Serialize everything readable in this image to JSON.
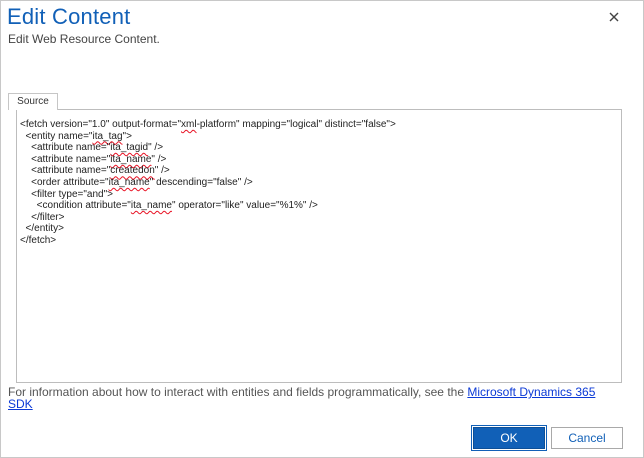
{
  "dialog": {
    "title": "Edit Content",
    "subtitle": "Edit Web Resource Content.",
    "close_icon": "close-icon"
  },
  "tabs": [
    {
      "label": "Source",
      "selected": true
    }
  ],
  "editor": {
    "lines": [
      "<fetch version=\"1.0\" output-format=\"xml-platform\" mapping=\"logical\" distinct=\"false\">",
      "  <entity name=\"ita_tag\">",
      "    <attribute name=\"ita_tagid\" />",
      "    <attribute name=\"ita_name\" />",
      "    <attribute name=\"createdon\" />",
      "    <order attribute=\"ita_name\" descending=\"false\" />",
      "    <filter type=\"and\">",
      "      <condition attribute=\"ita_name\" operator=\"like\" value=\"%1%\" />",
      "    </filter>",
      "  </entity>",
      "</fetch>"
    ]
  },
  "info": {
    "text": "For information about how to interact with entities and fields programmatically, see the ",
    "link_text": "Microsoft Dynamics 365 SDK"
  },
  "buttons": {
    "ok_label": "OK",
    "cancel_label": "Cancel"
  },
  "colors": {
    "accent": "#1160b7",
    "link": "#0b39d6",
    "spell_error": "#e81123"
  }
}
